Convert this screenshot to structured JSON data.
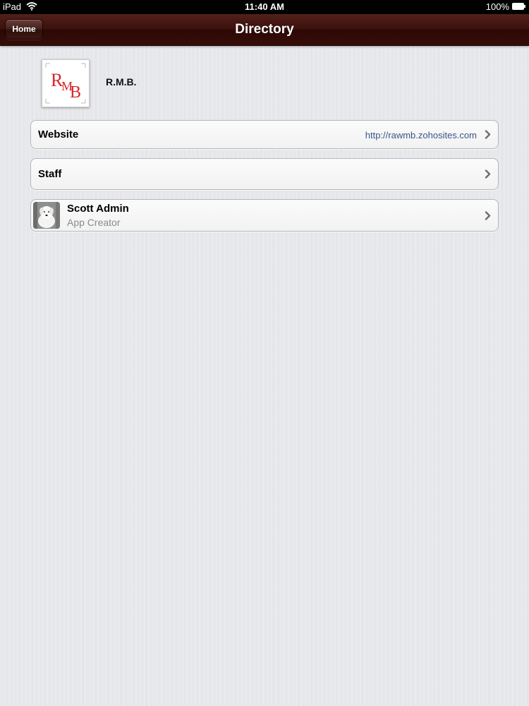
{
  "status_bar": {
    "device": "iPad",
    "time": "11:40 AM",
    "battery": "100%"
  },
  "nav": {
    "title": "Directory",
    "home_label": "Home"
  },
  "header": {
    "logo_text": "RMB",
    "org_name": "R.M.B."
  },
  "rows": {
    "website": {
      "label": "Website",
      "value": "http://rawmb.zohosites.com"
    },
    "staff": {
      "label": "Staff"
    },
    "person": {
      "name": "Scott Admin",
      "role": "App Creator"
    }
  },
  "colors": {
    "nav_bar": "#3b110c",
    "background": "#e6e7ea",
    "link_value": "#39558a",
    "logo_red": "#d8262b"
  }
}
